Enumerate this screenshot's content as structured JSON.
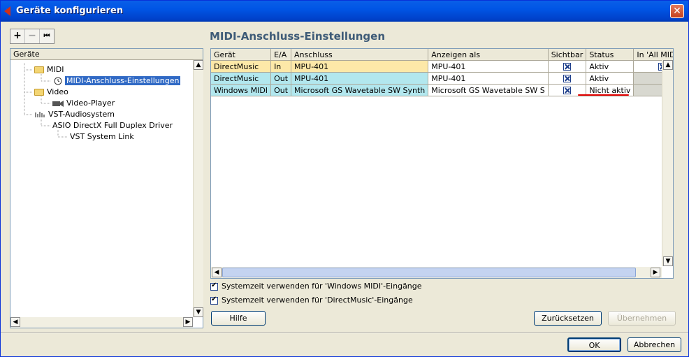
{
  "window": {
    "title": "Geräte konfigurieren",
    "close_glyph": "✕"
  },
  "toolbar": {
    "add": "+",
    "remove": "−",
    "reset": "⏮"
  },
  "panel_title": "MIDI-Anschluss-Einstellungen",
  "tree": {
    "header": "Geräte",
    "items": [
      {
        "label": "MIDI",
        "icon": "folder-icon"
      },
      {
        "label": "MIDI-Anschluss-Einstellungen",
        "icon": "clock-icon",
        "selected": true
      },
      {
        "label": "Video",
        "icon": "folder-icon"
      },
      {
        "label": "Video-Player",
        "icon": "video-player-icon"
      },
      {
        "label": "VST-Audiosystem",
        "icon": "audio-icon"
      },
      {
        "label": "ASIO DirectX Full Duplex Driver"
      },
      {
        "label": "VST System Link"
      }
    ]
  },
  "table": {
    "columns": [
      "Gerät",
      "E/A",
      "Anschluss",
      "Anzeigen als",
      "Sichtbar",
      "Status",
      "In 'All MIDI In"
    ],
    "rows": [
      {
        "geraet": "DirectMusic",
        "ea": "In",
        "anschluss": "MPU-401",
        "anzeigen": "MPU-401",
        "sichtbar": true,
        "status": "Aktiv",
        "all_midi_in": true
      },
      {
        "geraet": "DirectMusic",
        "ea": "Out",
        "anschluss": "MPU-401",
        "anzeigen": "MPU-401",
        "sichtbar": true,
        "status": "Aktiv",
        "all_midi_in": null
      },
      {
        "geraet": "Windows MIDI",
        "ea": "Out",
        "anschluss": "Microsoft GS Wavetable SW Synth",
        "anzeigen": "Microsoft GS Wavetable SW S",
        "sichtbar": true,
        "status": "Nicht aktiv",
        "all_midi_in": null
      }
    ]
  },
  "options": {
    "windows_midi": "Systemzeit verwenden für 'Windows MIDI'-Eingänge",
    "directmusic": "Systemzeit verwenden für 'DirectMusic'-Eingänge"
  },
  "buttons": {
    "help": "Hilfe",
    "reset": "Zurücksetzen",
    "apply": "Übernehmen",
    "ok": "OK",
    "cancel": "Abbrechen"
  },
  "colors": {
    "accent_title": "#3e5b77",
    "row_in": "#fde8a8",
    "row_out": "#b2e7ee",
    "highlight_underline": "#e00000",
    "selection": "#316ac5"
  }
}
